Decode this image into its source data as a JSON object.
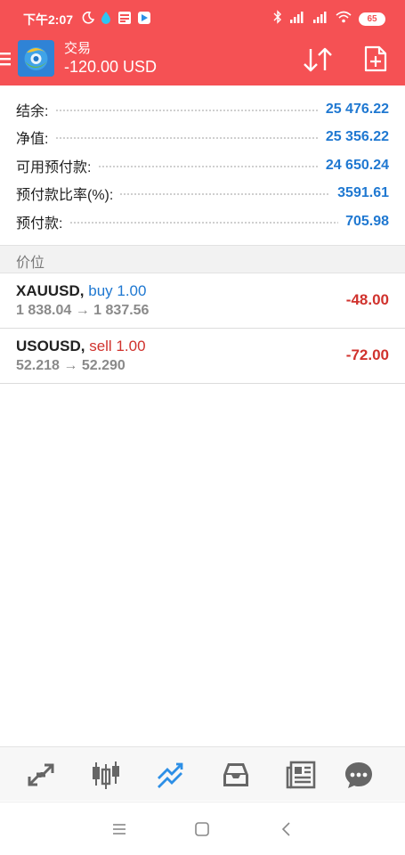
{
  "status_bar": {
    "time": "下午2:07",
    "battery": "65",
    "icons": [
      "moon-icon",
      "drop-icon",
      "app-icon",
      "play-icon",
      "bluetooth-icon",
      "signal-icon",
      "signal-icon",
      "wifi-icon",
      "battery-icon"
    ]
  },
  "header": {
    "title": "交易",
    "subtitle": "-120.00 USD",
    "accent_color": "#f55154",
    "icons": [
      "menu-icon",
      "sort-icon",
      "new-order-icon"
    ]
  },
  "summary": [
    {
      "label": "结余:",
      "value": "25 476.22"
    },
    {
      "label": "净值:",
      "value": "25 356.22"
    },
    {
      "label": "可用预付款:",
      "value": "24 650.24"
    },
    {
      "label": "预付款比率(%):",
      "value": "3591.61"
    },
    {
      "label": "预付款:",
      "value": "705.98"
    }
  ],
  "section": {
    "title": "价位"
  },
  "positions": [
    {
      "symbol": "XAUUSD,",
      "side": "buy 1.00",
      "prices": "1 838.04 → 1 837.56",
      "profit": "-48.00"
    },
    {
      "symbol": "USOUSD,",
      "side": "sell 1.00",
      "prices": "52.218 → 52.290",
      "profit": "-72.00"
    }
  ],
  "bottom_nav": {
    "items": [
      "quotes-icon",
      "chart-icon",
      "trade-icon",
      "history-icon",
      "news-icon",
      "chat-icon"
    ],
    "active": "trade-icon",
    "active_color": "#2d8fe6"
  },
  "system_nav": [
    "recents-button",
    "home-button",
    "back-button"
  ]
}
